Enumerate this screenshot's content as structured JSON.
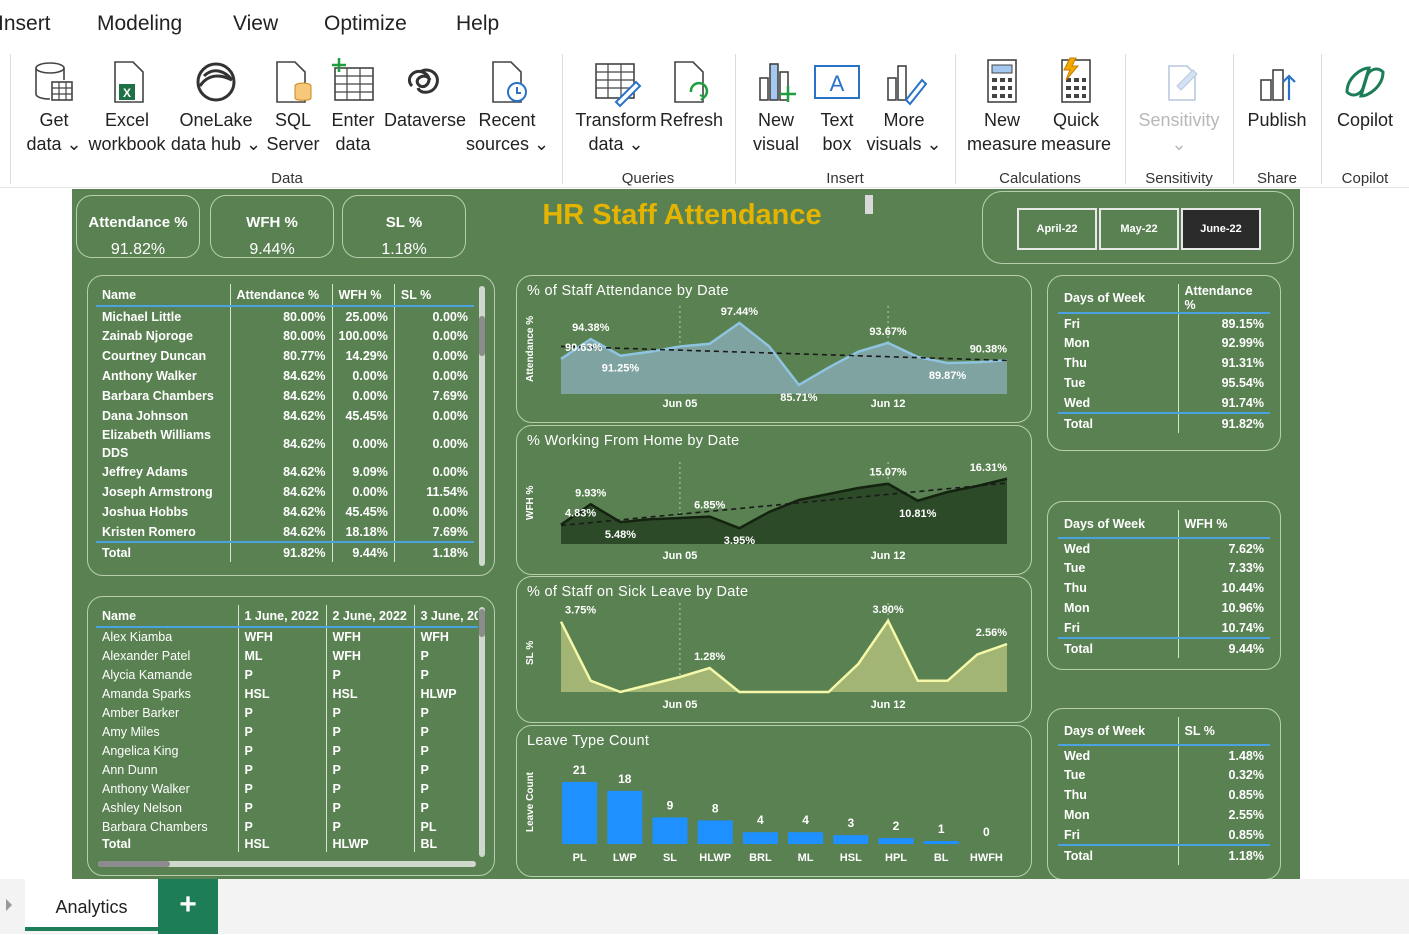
{
  "menu": [
    "Insert",
    "Modeling",
    "View",
    "Optimize",
    "Help"
  ],
  "ribbon": {
    "buttons": [
      {
        "l1": "Get",
        "l2": "data ⌄",
        "icon": "get-data-icon"
      },
      {
        "l1": "Excel",
        "l2": "workbook",
        "icon": "excel-icon"
      },
      {
        "l1": "OneLake",
        "l2": "data hub ⌄",
        "icon": "onelake-icon"
      },
      {
        "l1": "SQL",
        "l2": "Server",
        "icon": "sql-server-icon"
      },
      {
        "l1": "Enter",
        "l2": "data",
        "icon": "enter-data-icon"
      },
      {
        "l1": "Dataverse",
        "l2": "",
        "icon": "dataverse-icon"
      },
      {
        "l1": "Recent",
        "l2": "sources ⌄",
        "icon": "recent-sources-icon"
      },
      {
        "l1": "Transform",
        "l2": "data ⌄",
        "icon": "transform-data-icon"
      },
      {
        "l1": "Refresh",
        "l2": "",
        "icon": "refresh-icon"
      },
      {
        "l1": "New",
        "l2": "visual",
        "icon": "new-visual-icon"
      },
      {
        "l1": "Text",
        "l2": "box",
        "icon": "text-box-icon"
      },
      {
        "l1": "More",
        "l2": "visuals ⌄",
        "icon": "more-visuals-icon"
      },
      {
        "l1": "New",
        "l2": "measure",
        "icon": "new-measure-icon"
      },
      {
        "l1": "Quick",
        "l2": "measure",
        "icon": "quick-measure-icon"
      },
      {
        "l1": "Sensitivity",
        "l2": "⌄",
        "icon": "sensitivity-icon"
      },
      {
        "l1": "Publish",
        "l2": "",
        "icon": "publish-icon"
      },
      {
        "l1": "Copilot",
        "l2": "",
        "icon": "copilot-icon"
      }
    ],
    "groups": [
      "Data",
      "Queries",
      "Insert",
      "Calculations",
      "Sensitivity",
      "Share",
      "Copilot"
    ]
  },
  "dashboard": {
    "title": "HR Staff Attendance",
    "kpis": [
      {
        "title": "Attendance %",
        "value": "91.82%"
      },
      {
        "title": "WFH %",
        "value": "9.44%"
      },
      {
        "title": "SL %",
        "value": "1.18%"
      }
    ],
    "months": [
      "April-22",
      "May-22",
      "June-22"
    ],
    "selected_month": "June-22",
    "staff_table": {
      "headers": [
        "Name",
        "Attendance %",
        "WFH %",
        "SL %"
      ],
      "rows": [
        [
          "Michael Little",
          "80.00%",
          "25.00%",
          "0.00%"
        ],
        [
          "Zainab Njoroge",
          "80.00%",
          "100.00%",
          "0.00%"
        ],
        [
          "Courtney Duncan",
          "80.77%",
          "14.29%",
          "0.00%"
        ],
        [
          "Anthony Walker",
          "84.62%",
          "0.00%",
          "0.00%"
        ],
        [
          "Barbara Chambers",
          "84.62%",
          "0.00%",
          "7.69%"
        ],
        [
          "Dana Johnson",
          "84.62%",
          "45.45%",
          "0.00%"
        ],
        [
          "Elizabeth Williams DDS",
          "84.62%",
          "0.00%",
          "0.00%"
        ],
        [
          "Jeffrey Adams",
          "84.62%",
          "9.09%",
          "0.00%"
        ],
        [
          "Joseph Armstrong",
          "84.62%",
          "0.00%",
          "11.54%"
        ],
        [
          "Joshua Hobbs",
          "84.62%",
          "45.45%",
          "0.00%"
        ],
        [
          "Kristen Romero",
          "84.62%",
          "18.18%",
          "7.69%"
        ]
      ],
      "total": [
        "Total",
        "91.82%",
        "9.44%",
        "1.18%"
      ]
    },
    "daily_table": {
      "headers": [
        "Name",
        "1 June, 2022",
        "2 June, 2022",
        "3 June, 20"
      ],
      "rows": [
        [
          "Alex Kiamba",
          "WFH",
          "WFH",
          "WFH"
        ],
        [
          "Alexander Patel",
          "ML",
          "WFH",
          "P"
        ],
        [
          "Alycia Kamande",
          "P",
          "P",
          "P"
        ],
        [
          "Amanda Sparks",
          "HSL",
          "HSL",
          "HLWP"
        ],
        [
          "Amber Barker",
          "P",
          "P",
          "P"
        ],
        [
          "Amy Miles",
          "P",
          "P",
          "P"
        ],
        [
          "Angelica King",
          "P",
          "P",
          "P"
        ],
        [
          "Ann Dunn",
          "P",
          "P",
          "P"
        ],
        [
          "Anthony Walker",
          "P",
          "P",
          "P"
        ],
        [
          "Ashley Nelson",
          "P",
          "P",
          "P"
        ],
        [
          "Barbara Chambers",
          "P",
          "P",
          "PL"
        ]
      ],
      "total": [
        "Total",
        "HSL",
        "HLWP",
        "BL"
      ]
    },
    "dow_attendance": {
      "headers": [
        "Days of Week",
        "Attendance %"
      ],
      "rows": [
        [
          "Fri",
          "89.15%"
        ],
        [
          "Mon",
          "92.99%"
        ],
        [
          "Thu",
          "91.31%"
        ],
        [
          "Tue",
          "95.54%"
        ],
        [
          "Wed",
          "91.74%"
        ]
      ],
      "total": [
        "Total",
        "91.82%"
      ]
    },
    "dow_wfh": {
      "headers": [
        "Days of Week",
        "WFH %"
      ],
      "rows": [
        [
          "Wed",
          "7.62%"
        ],
        [
          "Tue",
          "7.33%"
        ],
        [
          "Thu",
          "10.44%"
        ],
        [
          "Mon",
          "10.96%"
        ],
        [
          "Fri",
          "10.74%"
        ]
      ],
      "total": [
        "Total",
        "9.44%"
      ]
    },
    "dow_sl": {
      "headers": [
        "Days of Week",
        "SL %"
      ],
      "rows": [
        [
          "Wed",
          "1.48%"
        ],
        [
          "Tue",
          "0.32%"
        ],
        [
          "Thu",
          "0.85%"
        ],
        [
          "Mon",
          "2.55%"
        ],
        [
          "Fri",
          "0.85%"
        ]
      ],
      "total": [
        "Total",
        "1.18%"
      ]
    }
  },
  "tabs": {
    "active": "Analytics",
    "add_label": "+"
  },
  "chart_data": [
    {
      "type": "area",
      "title": "% of Staff Attendance by Date",
      "ylabel": "Attendance %",
      "xticks": [
        "Jun 05",
        "Jun 12"
      ],
      "x": [
        1,
        2,
        3,
        4,
        5,
        6,
        7,
        8,
        9,
        10,
        11,
        12,
        13,
        14,
        15,
        16
      ],
      "values": [
        90.63,
        94.38,
        91.25,
        92.0,
        93.0,
        93.5,
        97.44,
        93.0,
        85.71,
        89.0,
        92.0,
        93.67,
        91.0,
        89.87,
        90.0,
        90.38
      ],
      "labels": {
        "2": "94.38%",
        "1": "90.63%",
        "3": "91.25%",
        "7": "97.44%",
        "9": "85.71%",
        "12": "93.67%",
        "14": "89.87%",
        "16": "90.38%"
      },
      "trendline": true,
      "color": "#7fb8d8"
    },
    {
      "type": "area",
      "title": "% Working From Home by Date",
      "ylabel": "WFH %",
      "xticks": [
        "Jun 05",
        "Jun 12"
      ],
      "x": [
        1,
        2,
        3,
        4,
        5,
        6,
        7,
        8,
        9,
        10,
        11,
        12,
        13,
        14,
        15,
        16
      ],
      "values": [
        4.83,
        9.93,
        5.48,
        6.2,
        6.5,
        6.85,
        3.95,
        8.0,
        11.0,
        12.5,
        14.0,
        15.07,
        10.81,
        13.0,
        14.5,
        16.31
      ],
      "labels": {
        "1": "4.83%",
        "2": "9.93%",
        "3": "5.48%",
        "6": "6.85%",
        "7": "3.95%",
        "12": "15.07%",
        "13": "10.81%",
        "16": "16.31%"
      },
      "trendline": true,
      "color": "#1f3a1c"
    },
    {
      "type": "area",
      "title": "% of Staff on Sick Leave by Date",
      "ylabel": "SL %",
      "xticks": [
        "Jun 05",
        "Jun 12"
      ],
      "x": [
        1,
        2,
        3,
        4,
        5,
        6,
        7,
        8,
        9,
        10,
        11,
        12,
        13,
        14,
        15,
        16
      ],
      "values": [
        3.75,
        0.6,
        0.0,
        0.4,
        0.8,
        1.28,
        0.0,
        0.0,
        0.0,
        0.0,
        1.5,
        3.8,
        0.6,
        0.6,
        2.0,
        2.56
      ],
      "labels": {
        "1": "3.75%",
        "6": "1.28%",
        "12": "3.80%",
        "16": "2.56%"
      },
      "trendline": false,
      "color": "#f0f5a0"
    },
    {
      "type": "bar",
      "title": "Leave Type Count",
      "ylabel": "Leave Count",
      "categories": [
        "PL",
        "LWP",
        "SL",
        "HLWP",
        "BRL",
        "ML",
        "HSL",
        "HPL",
        "BL",
        "HWFH"
      ],
      "values": [
        21,
        18,
        9,
        8,
        4,
        4,
        3,
        2,
        1,
        0
      ],
      "color": "#1e90ff"
    }
  ]
}
